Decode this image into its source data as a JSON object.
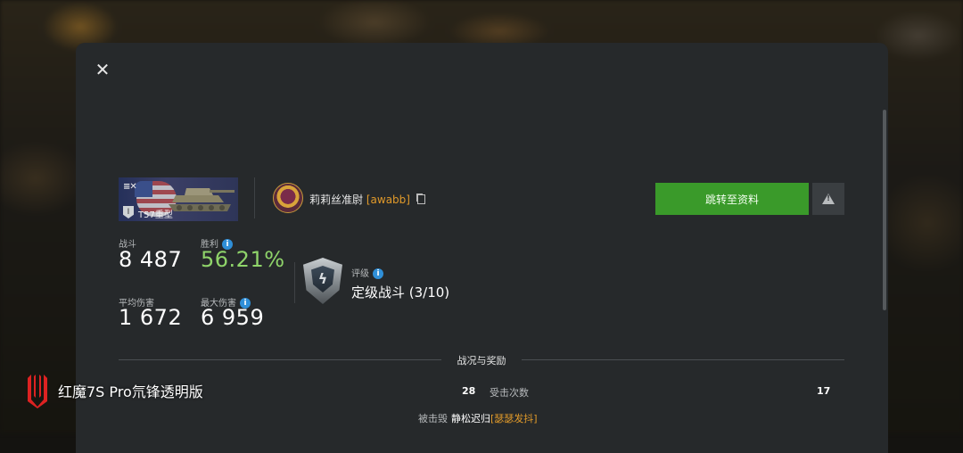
{
  "dialog": {
    "close_label": "✕"
  },
  "tank": {
    "name": "T57重型",
    "tier": "I",
    "class_icon": "heavy-tank-icon"
  },
  "player": {
    "name": "莉莉丝准尉",
    "clan": "[awabb]",
    "avatar_icon": "player-avatar-emblem"
  },
  "actions": {
    "profile_button": "跳转至资料",
    "report_icon": "warning-icon"
  },
  "stats": {
    "battles_label": "战斗",
    "battles_value": "8 487",
    "wins_label": "胜利",
    "wins_value": "56.21%",
    "avg_damage_label": "平均伤害",
    "avg_damage_value": "1 672",
    "max_damage_label": "最大伤害",
    "max_damage_value": "6 959"
  },
  "rating": {
    "label": "评级",
    "value": "定级战斗 (3/10)"
  },
  "section": {
    "title": "战况与奖励"
  },
  "battle_row": {
    "left_value": "28",
    "label": "受击次数",
    "right_value": "17"
  },
  "destroyed_by": {
    "label": "被击毁",
    "killer_name": "静松迟归",
    "killer_clan": "[瑟瑟发抖]"
  },
  "watermark": {
    "text": "红魔7S Pro氘锋透明版"
  },
  "colors": {
    "accent_green": "#3a9a2a",
    "win_green": "#8fd46a",
    "clan_orange": "#e19a2a",
    "info_blue": "#2f8fd8",
    "dialog_bg": "#26292b"
  }
}
